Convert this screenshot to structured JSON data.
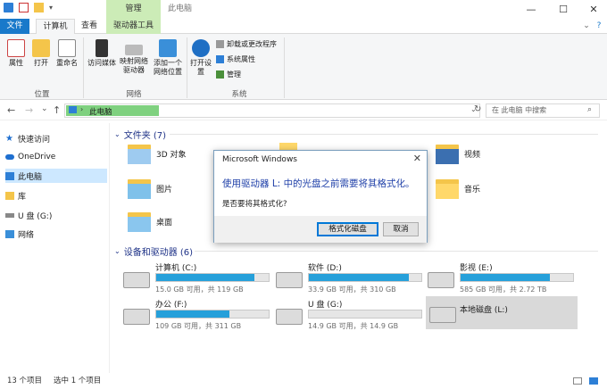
{
  "window": {
    "context_tab": "管理",
    "title": "此电脑",
    "min": "—",
    "max": "☐",
    "close": "✕"
  },
  "tabs": {
    "file": "文件",
    "computer": "计算机",
    "view": "查看",
    "drive_tools": "驱动器工具"
  },
  "ribbon": {
    "properties": "属性",
    "open": "打开",
    "rename": "重命名",
    "location_group": "位置",
    "media": "访问媒体",
    "map_drive": "映射网络驱动器",
    "add_location": "添加一个网络位置",
    "network_group": "网络",
    "open_settings": "打开设置",
    "uninstall": "卸载或更改程序",
    "sys_props": "系统属性",
    "manage": "管理",
    "system_group": "系统"
  },
  "nav": {
    "back": "←",
    "forward": "→",
    "recent": "⌄",
    "up": "↑",
    "address": "此电脑",
    "refresh": "↻",
    "search_placeholder": "在 此电脑 中搜索"
  },
  "sidebar": {
    "items": [
      {
        "label": "快速访问"
      },
      {
        "label": "OneDrive"
      },
      {
        "label": "此电脑"
      },
      {
        "label": "库"
      },
      {
        "label": "U 盘 (G:)"
      },
      {
        "label": "网络"
      }
    ]
  },
  "main": {
    "folders_header": "文件夹 (7)",
    "folders": [
      "3D 对象",
      "视频",
      "图片",
      "音乐",
      "桌面"
    ],
    "devices_header": "设备和驱动器 (6)",
    "drives": [
      {
        "name": "计算机 (C:)",
        "info": "15.0 GB 可用，共 119 GB",
        "used": 0.87
      },
      {
        "name": "软件 (D:)",
        "info": "33.9 GB 可用，共 310 GB",
        "used": 0.89
      },
      {
        "name": "影视 (E:)",
        "info": "585 GB 可用，共 2.72 TB",
        "used": 0.79
      },
      {
        "name": "办公 (F:)",
        "info": "109 GB 可用，共 311 GB",
        "used": 0.65
      },
      {
        "name": "U 盘 (G:)",
        "info": "14.9 GB 可用，共 14.9 GB",
        "used": 0.0
      },
      {
        "name": "本地磁盘 (L:)"
      }
    ]
  },
  "status": {
    "count": "13 个项目",
    "selected": "选中 1 个项目"
  },
  "dialog": {
    "title": "Microsoft Windows",
    "message": "使用驱动器 L: 中的光盘之前需要将其格式化。",
    "question": "是否要将其格式化?",
    "format_button": "格式化磁盘",
    "cancel_button": "取消"
  },
  "colors": {
    "accent": "#1979ca",
    "drive_fill": "#26a0da",
    "selection": "#cde8ff",
    "address_highlight": "#7fd17f",
    "context_tab": "#ccecb7"
  }
}
